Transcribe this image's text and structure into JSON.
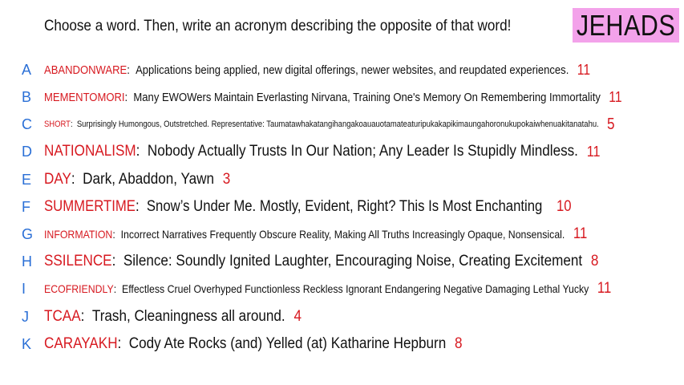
{
  "prompt": "Choose a word. Then, write an acronym describing the opposite of that word!",
  "badge": "JEHADS",
  "colors": {
    "letter": "#2a6fd6",
    "word": "#d71920",
    "count": "#d71920",
    "badge_bg": "#f3a2ea"
  },
  "rows": [
    {
      "letter": "A",
      "word": "ABANDONWARE",
      "desc": "Applications being applied, new digital offerings, newer websites, and reupdated experiences.",
      "count": "11"
    },
    {
      "letter": "B",
      "word": "MEMENTOMORI",
      "desc": "Many EWOWers Maintain Everlasting Nirvana, Training One's Memory On Remembering Immortality",
      "count": "11"
    },
    {
      "letter": "C",
      "word": "SHORT",
      "desc": "Surprisingly Humongous, Outstretched. Representative: Taumatawhakatangihangakoauauotamateaturipukakapikimaungahoronukupokaiwhenuakitanatahu.",
      "count": "5"
    },
    {
      "letter": "D",
      "word": "NATIONALISM",
      "desc": "Nobody Actually Trusts In Our Nation; Any Leader Is Stupidly Mindless.",
      "count": "11"
    },
    {
      "letter": "E",
      "word": "DAY",
      "desc": "Dark, Abaddon, Yawn",
      "count": "3"
    },
    {
      "letter": "F",
      "word": "SUMMERTIME",
      "desc": "Snow’s Under Me. Mostly, Evident, Right? This Is Most Enchanting",
      "count": "10"
    },
    {
      "letter": "G",
      "word": "INFORMATION",
      "desc": "Incorrect Narratives Frequently Obscure Reality, Making All Truths Increasingly Opaque, Nonsensical.",
      "count": "11"
    },
    {
      "letter": "H",
      "word": "SSILENCE",
      "desc": "Silence: Soundly Ignited Laughter, Encouraging Noise, Creating Excitement",
      "count": "8"
    },
    {
      "letter": "I",
      "word": "ECOFRIENDLY",
      "desc": "Effectless Cruel Overhyped Functionless Reckless Ignorant Endangering Negative Damaging Lethal Yucky",
      "count": "11"
    },
    {
      "letter": "J",
      "word": "TCAA",
      "desc": "Trash, Cleaningness all around.",
      "count": "4"
    },
    {
      "letter": "K",
      "word": "CARAYAKH",
      "desc": "Cody Ate Rocks (and) Yelled (at) Katharine Hepburn",
      "count": "8"
    }
  ]
}
